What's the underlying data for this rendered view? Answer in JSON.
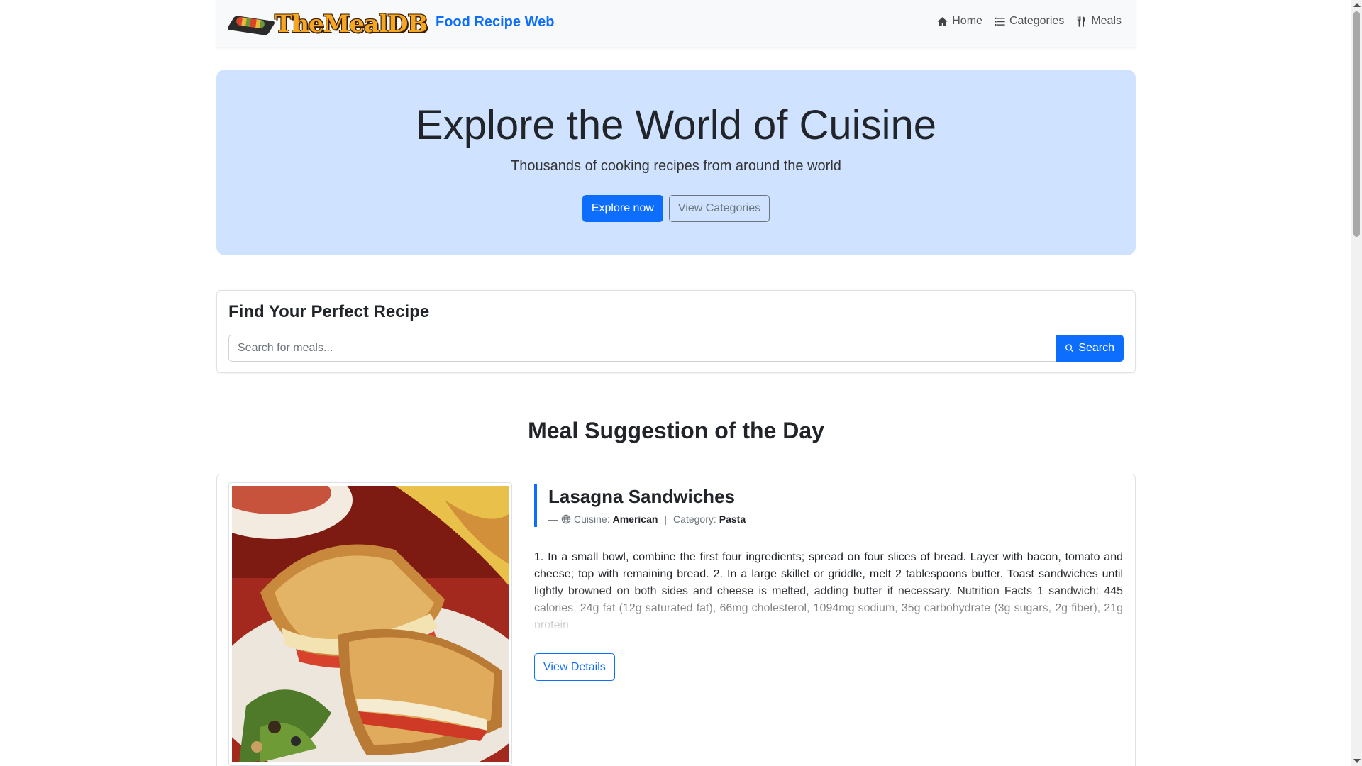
{
  "navbar": {
    "logo_text": "TheMealDB",
    "site_title": "Food Recipe Web",
    "links": [
      {
        "label": "Home",
        "icon": "home-icon"
      },
      {
        "label": "Categories",
        "icon": "list-icon"
      },
      {
        "label": "Meals",
        "icon": "utensils-icon"
      }
    ]
  },
  "hero": {
    "title": "Explore the World of Cuisine",
    "subtitle": "Thousands of cooking recipes from around the world",
    "primary_button": "Explore now",
    "secondary_button": "View Categories"
  },
  "search": {
    "heading": "Find Your Perfect Recipe",
    "placeholder": "Search for meals...",
    "value": "",
    "button_label": "Search"
  },
  "suggestion": {
    "section_title": "Meal Suggestion of the Day",
    "meal": {
      "name": "Lasagna Sandwiches",
      "dash": "—",
      "cuisine_label": "Cuisine:",
      "cuisine": "American",
      "separator": "|",
      "category_label": "Category:",
      "category": "Pasta",
      "description": "1. In a small bowl, combine the first four ingredients; spread on four slices of bread. Layer with bacon, tomato and cheese; top with remaining bread. 2. In a large skillet or griddle, melt 2 tablespoons butter. Toast sandwiches until lightly browned on both sides and cheese is melted, adding butter if necessary. Nutrition Facts 1 sandwich: 445 calories, 24g fat (12g saturated fat), 66mg cholesterol, 1094mg sodium, 35g carbohydrate (3g sugars, 2g fiber), 21g protein",
      "details_button": "View Details"
    }
  },
  "colors": {
    "primary": "#0d6efd",
    "hero_bg": "#cfe2ff",
    "navbar_bg": "#f8f9fa"
  }
}
